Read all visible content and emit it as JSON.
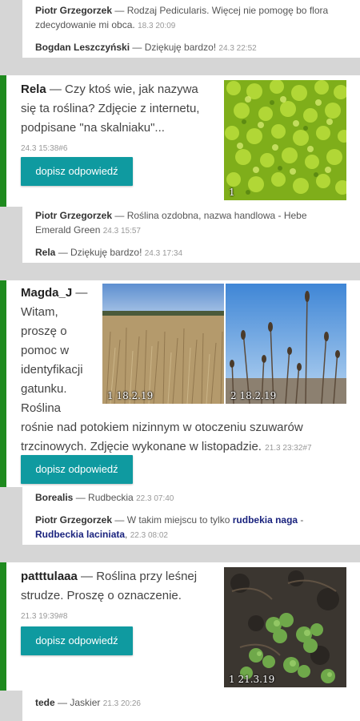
{
  "top_replies": [
    {
      "author": "Piotr Grzegorzek",
      "text": " — Rodzaj Pedicularis. Więcej nie pomogę bo flora",
      "text2": "zdecydowanie mi obca.",
      "time": "18.3 20:09"
    },
    {
      "author": "Bogdan Leszczyński",
      "text": " — Dziękuję bardzo!",
      "time": "24.3 22:52"
    }
  ],
  "posts": [
    {
      "author": "Rela",
      "lines": [
        " — Czy ktoś wie, jak nazywa",
        "się ta roślina? Zdjęcie z internetu,",
        "podpisane \"na skalniaku\"..."
      ],
      "meta": "24.3 15:38#6",
      "button": "dopisz odpowiedź",
      "photo_caption": "1",
      "replies": [
        {
          "author": "Piotr Grzegorzek",
          "text": " — Roślina ozdobna, nazwa handlowa - Hebe",
          "text2": "Emerald Green",
          "time": "24.3 15:57"
        },
        {
          "author": "Rela",
          "text": " — Dziękuję bardzo!",
          "time": "24.3 17:34"
        }
      ]
    },
    {
      "author": "Magda_J",
      "lines": [
        " —",
        "Witam,",
        "proszę o",
        "pomoc w",
        "identyfikacji",
        "gatunku.",
        "Roślina",
        "rośnie nad potokiem nizinnym w otoczeniu szuwarów",
        "trzcinowych. Zdjęcie wykonane w listopadzie."
      ],
      "meta": "21.3 23:32#7",
      "button": "dopisz odpowiedź",
      "photo_captions": [
        "1  18.2.19",
        "2  18.2.19"
      ],
      "replies": [
        {
          "author": "Borealis",
          "text": " — Rudbeckia",
          "time": "22.3 07:40"
        },
        {
          "author": "Piotr Grzegorzek",
          "text": " — W takim miejscu to tylko ",
          "link1": "rudbekia naga",
          "sep": " -",
          "link2": "Rudbeckia laciniata",
          "time": "22.3 08:02"
        }
      ]
    },
    {
      "author": "patttulaaa",
      "lines": [
        " — Roślina przy leśnej",
        "strudze. Proszę o oznaczenie."
      ],
      "meta": "21.3 19:39#8",
      "button": "dopisz odpowiedź",
      "photo_caption": "1  21.3.19",
      "replies": [
        {
          "author": "tede",
          "text": " — Jaskier",
          "time": "21.3 20:26"
        }
      ]
    }
  ],
  "colors": {
    "accent_bar": "#1e8a1e",
    "button": "#0f9aa0",
    "link": "#1a237e",
    "gap": "#d6d6d6"
  }
}
